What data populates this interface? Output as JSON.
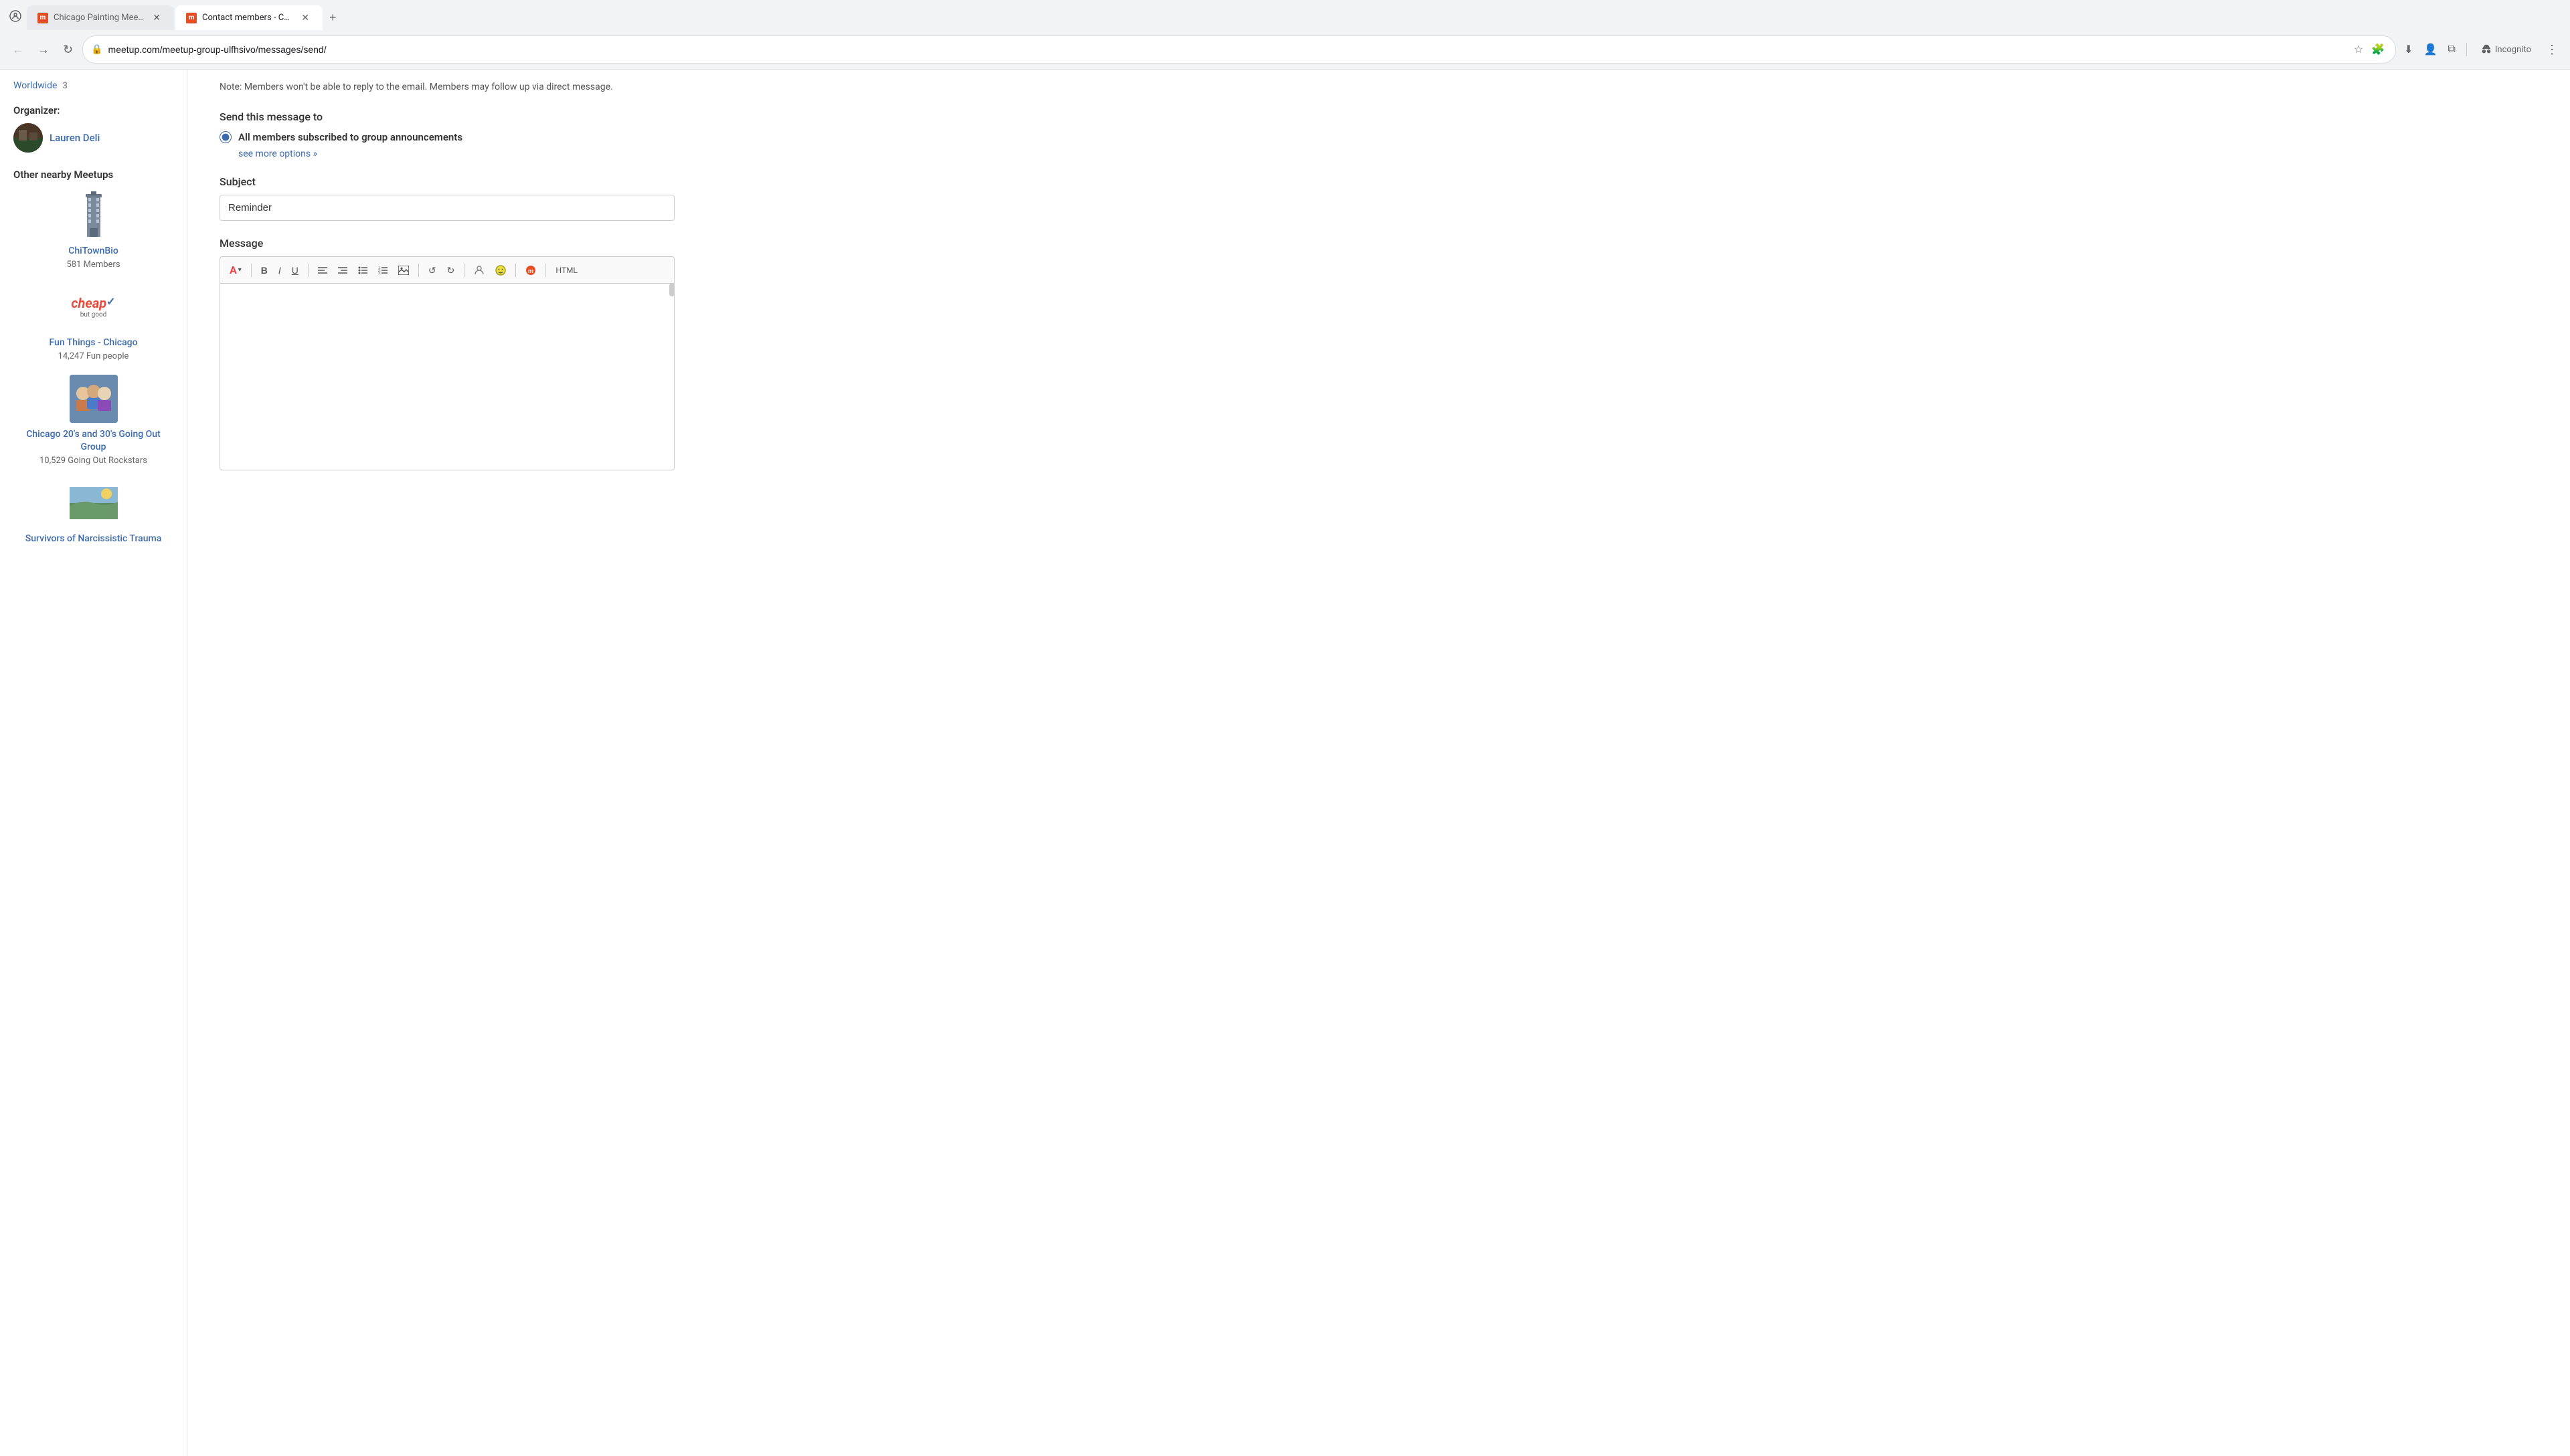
{
  "browser": {
    "tabs": [
      {
        "id": "tab1",
        "title": "Chicago Painting Meetup Grou...",
        "active": false,
        "favicon_color": "#e44d26"
      },
      {
        "id": "tab2",
        "title": "Contact members - Chicago Pa...",
        "active": true,
        "favicon_color": "#e44d26"
      }
    ],
    "address": "meetup.com/meetup-group-ulfhsivo/messages/send/",
    "incognito_label": "Incognito"
  },
  "sidebar": {
    "worldwide_label": "Worldwide",
    "worldwide_count": "3",
    "organizer_label": "Organizer:",
    "organizer_name": "Lauren Deli",
    "nearby_title": "Other nearby Meetups",
    "meetups": [
      {
        "name": "ChiTownBio",
        "members": "581 Members",
        "type": "building"
      },
      {
        "name": "Fun Things - Chicago",
        "members": "14,247 Fun people",
        "type": "cheap"
      },
      {
        "name": "Chicago 20's and 30's Going Out Group",
        "members": "10,529 Going Out Rockstars",
        "type": "group-photo"
      },
      {
        "name": "Survivors of Narcissistic Trauma",
        "members": "",
        "type": "landscape"
      }
    ]
  },
  "main": {
    "note_text": "Note: Members won't be able to reply to the email. Members may follow up via direct message.",
    "send_label": "Send this message to",
    "radio_option_label": "All members subscribed to group announcements",
    "see_more_label": "see more options »",
    "subject_label": "Subject",
    "subject_value": "Reminder",
    "message_label": "Message",
    "toolbar": {
      "font_btn": "A",
      "bold_btn": "B",
      "italic_btn": "I",
      "underline_btn": "U",
      "align_left": "≡",
      "align_right": "≡",
      "ul_btn": "☰",
      "ol_btn": "☰",
      "image_btn": "⊞",
      "undo_btn": "↺",
      "redo_btn": "↻",
      "emoji_btn": "☺",
      "smile_btn": "☻",
      "more_btn": "▼",
      "html_btn": "HTML"
    }
  }
}
